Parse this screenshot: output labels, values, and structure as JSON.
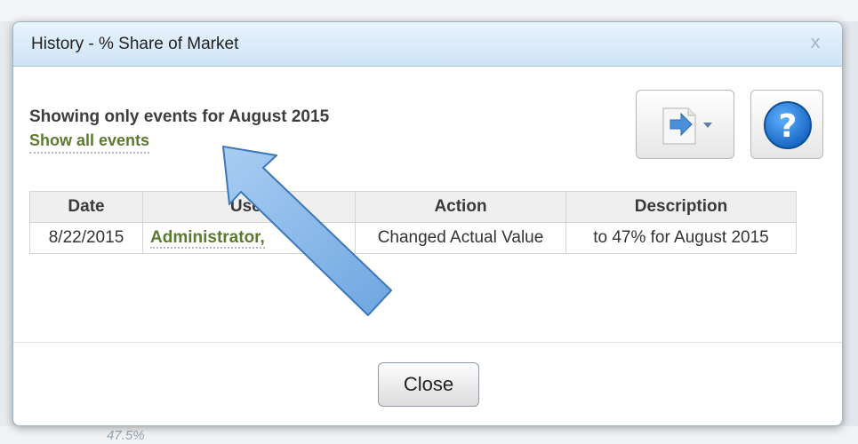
{
  "dialog": {
    "title": "History - % Share of Market",
    "close_icon": "x",
    "filter_notice": "Showing only events for August 2015",
    "show_all_link": "Show all events",
    "buttons": {
      "export_icon": "export-dropdown-icon",
      "help_icon": "help-icon",
      "close_label": "Close"
    },
    "table": {
      "headers": [
        "Date",
        "User",
        "Action",
        "Description"
      ],
      "rows": [
        {
          "date": "8/22/2015",
          "user": "Administrator, ",
          "action": "Changed Actual Value",
          "description": "to 47% for August 2015"
        }
      ]
    }
  },
  "backdrop": {
    "bottom_fragment": "47.5%"
  },
  "colors": {
    "title_bar": "#d6e8f8",
    "link_green": "#5b7a2f",
    "help_blue": "#1e78d2",
    "annotation_arrow": "#7fb1e6"
  }
}
